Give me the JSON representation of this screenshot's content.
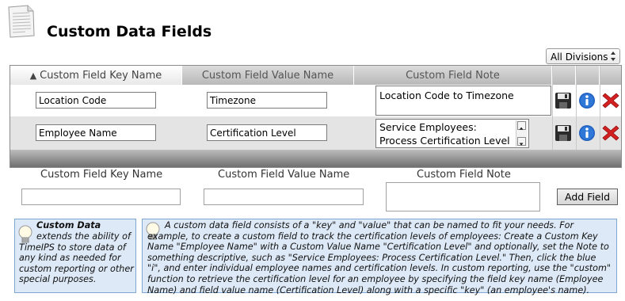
{
  "header": {
    "title": "Custom Data Fields",
    "icon": "document-icon"
  },
  "division_select": {
    "value": "All Divisions"
  },
  "table": {
    "columns": [
      {
        "label": "Custom Field Key Name",
        "sort_indicator": "▲"
      },
      {
        "label": "Custom Field Value Name"
      },
      {
        "label": "Custom Field Note"
      }
    ],
    "rows": [
      {
        "key": "Location Code",
        "value": "Timezone",
        "note": "Location Code to Timezone"
      },
      {
        "key": "Employee Name",
        "value": "Certification Level",
        "note_line1": "Service Employees:",
        "note_line2": "Process Certification Level"
      }
    ],
    "action_icons": [
      "save-icon",
      "info-icon",
      "delete-icon"
    ]
  },
  "add_form": {
    "key_label": "Custom Field Key Name",
    "value_label": "Custom Field Value Name",
    "note_label": "Custom Field Note",
    "button_label": "Add Field"
  },
  "help_left": {
    "title": "Custom Data",
    "text": "extends the ability of TimeIPS to store data of any kind as needed for custom reporting or other special purposes."
  },
  "help_right": {
    "text": "A custom data field consists of a \"key\" and \"value\" that can be named to fit your needs. For example, to create a custom field to track the certification levels of employees: Create a Custom Key Name \"Employee Name\" with a Custom Value Name \"Certification Level\" and optionally, set the Note to something descriptive, such as \"Service Employees: Process Certification Level.\" Then, click the blue \"i\", and enter individual employee names and certification levels. In custom reporting, use the \"custom\" function to retrieve the certification level for an employee by specifying the field key name (Employee Name) and field value name (Certification Level) along with a specific \"key\" (an employee's name)."
  },
  "colors": {
    "info_bg": "#dde9f6",
    "info_border": "#7fa7d4",
    "delete_red": "#d42020",
    "info_blue": "#1f5fbf"
  }
}
